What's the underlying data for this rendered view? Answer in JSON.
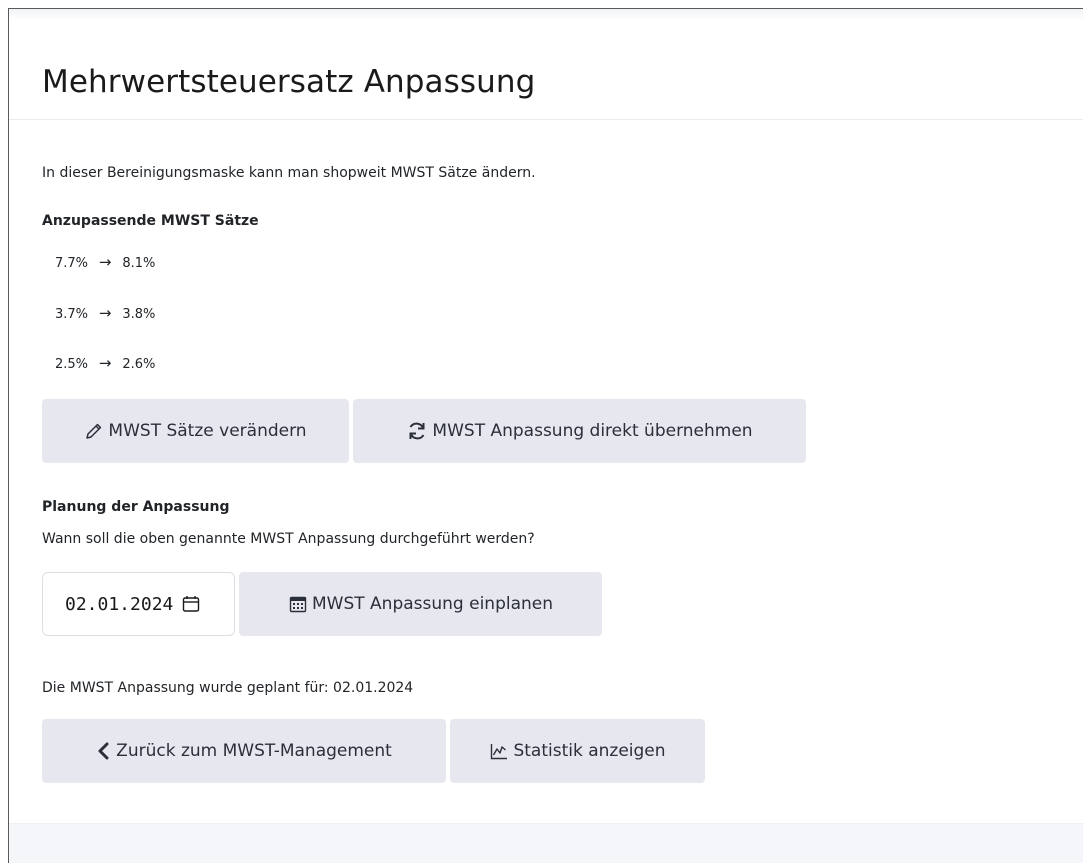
{
  "page": {
    "title": "Mehrwertsteuersatz Anpassung",
    "intro": "In dieser Bereinigungsmaske kann man shopweit MWST Sätze ändern."
  },
  "rates": {
    "heading": "Anzupassende MWST Sätze",
    "items": [
      {
        "from": "7.7%",
        "arrow": "→",
        "to": "8.1%"
      },
      {
        "from": "3.7%",
        "arrow": "→",
        "to": "3.8%"
      },
      {
        "from": "2.5%",
        "arrow": "→",
        "to": "2.6%"
      }
    ]
  },
  "actions": {
    "edit_label": "MWST Sätze verändern",
    "apply_label": "MWST Anpassung direkt übernehmen"
  },
  "planning": {
    "heading": "Planung der Anpassung",
    "question": "Wann soll die oben genannte MWST Anpassung durchgeführt werden?",
    "date_value": "02.01.2024",
    "schedule_label": "MWST Anpassung einplanen",
    "status": "Die MWST Anpassung wurde geplant für: 02.01.2024"
  },
  "nav": {
    "back_label": "Zurück zum MWST-Management",
    "stats_label": "Statistik anzeigen"
  },
  "icons": {
    "edit": "pencil-icon",
    "apply": "refresh-icon",
    "date": "calendar-icon",
    "schedule": "calendar-grid-icon",
    "back": "chevron-left-icon",
    "stats": "line-chart-icon"
  },
  "colors": {
    "button_bg": "#e7e8ef",
    "footer_bg": "#f4f6fa"
  }
}
